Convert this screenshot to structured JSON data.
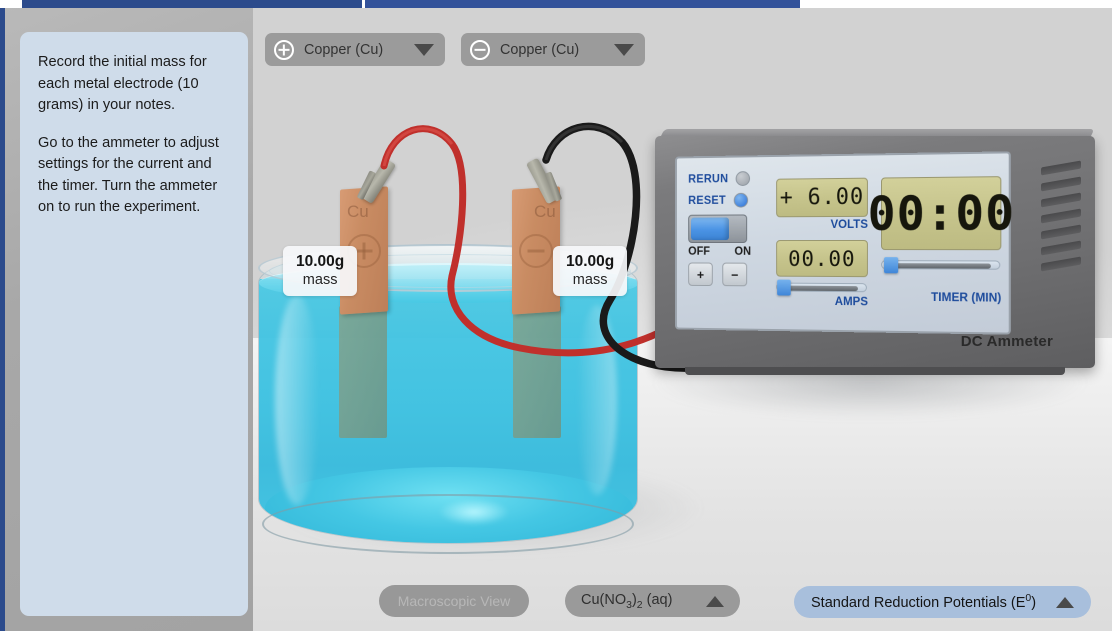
{
  "instructions": {
    "paragraph_1": "Record the initial mass for each metal electrode (10 grams) in your notes.",
    "paragraph_2": "Go to the ammeter to adjust settings for the current and the timer. Turn the ammeter on to run the experiment."
  },
  "electrode_selectors": {
    "anode": {
      "sign": "+",
      "label": "Copper (Cu)"
    },
    "cathode": {
      "sign": "−",
      "label": "Copper (Cu)"
    }
  },
  "electrodes": {
    "anode": {
      "material_symbol": "Cu",
      "charge": "+",
      "mass_value": "10.00g",
      "mass_unit": "mass"
    },
    "cathode": {
      "material_symbol": "Cu",
      "charge": "−",
      "mass_value": "10.00g",
      "mass_unit": "mass"
    }
  },
  "ammeter": {
    "device_label": "DC Ammeter",
    "rerun_label": "RERUN",
    "reset_label": "RESET",
    "off_label": "OFF",
    "on_label": "ON",
    "switch_state": "OFF",
    "terminal_positive": "+",
    "terminal_negative": "−",
    "volts_value": "+ 6.00",
    "volts_label": "VOLTS",
    "amps_value": "00.00",
    "amps_label": "AMPS",
    "timer_value": "00:00",
    "timer_label": "TIMER (MIN)"
  },
  "bottom_bar": {
    "macroscopic_view": "Macroscopic View",
    "solution_label": "Cu(NO3)2 (aq)",
    "solution_prefix": "Cu(NO",
    "solution_sub1": "3",
    "solution_mid": ")",
    "solution_sub2": "2",
    "solution_suffix": " (aq)",
    "srp_prefix": "Standard Reduction Potentials (E",
    "srp_sup": "0",
    "srp_suffix": ")"
  },
  "colors": {
    "accent_blue": "#2c4b8c",
    "panel_blue": "#cfdcea",
    "srp_button": "#a8bfdc",
    "lcd_green": "#c6c48c",
    "solution_cyan": "#3dc3e2",
    "copper": "#c98c63",
    "wire_positive": "#c0302c",
    "wire_negative": "#1a1a1a"
  }
}
